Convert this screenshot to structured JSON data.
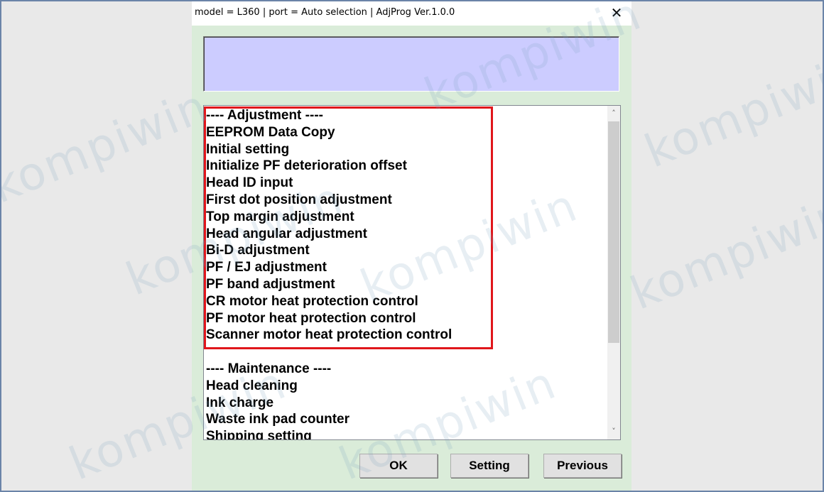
{
  "window": {
    "title": "model = L360 | port = Auto selection | AdjProg Ver.1.0.0",
    "close_glyph": "✕"
  },
  "status_panel": {
    "text": "",
    "background": "#ccccff"
  },
  "list": {
    "items": [
      "---- Adjustment ----",
      "EEPROM Data Copy",
      "Initial setting",
      "Initialize PF deterioration offset",
      "Head ID input",
      "First dot position adjustment",
      "Top margin adjustment",
      "Head angular adjustment",
      "Bi-D adjustment",
      "PF / EJ adjustment",
      "PF band adjustment",
      "CR motor heat protection control",
      "PF motor heat protection control",
      "Scanner motor heat protection control",
      "",
      "---- Maintenance ----",
      "Head cleaning",
      "Ink charge",
      "Waste ink pad counter",
      "Shipping setting"
    ],
    "highlight_color": "#e0161b"
  },
  "scrollbar": {
    "up_glyph": "˄",
    "down_glyph": "˅"
  },
  "buttons": {
    "ok": "OK",
    "setting": "Setting",
    "previous": "Previous"
  },
  "watermark": {
    "text": "kompiwin"
  },
  "colors": {
    "dialog_background": "#daecd9",
    "page_background": "#e9e9e9",
    "frame_border": "#6b84a8"
  }
}
